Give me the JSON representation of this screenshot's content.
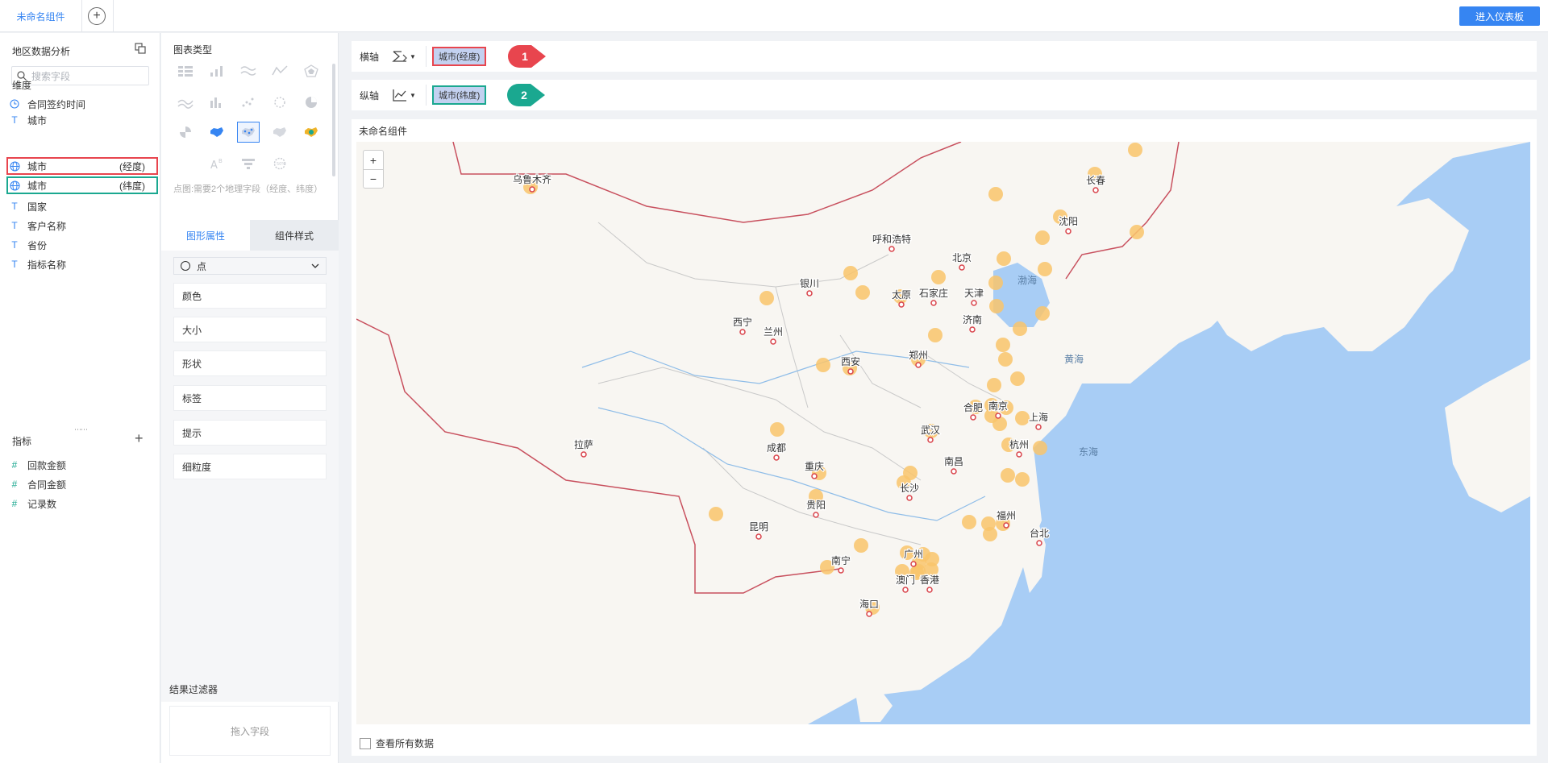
{
  "topbar": {
    "tab_label": "未命名组件",
    "enter_dashboard": "进入仪表板"
  },
  "fields_pane": {
    "dataset_title": "地区数据分析",
    "search_placeholder": "搜索字段",
    "dimensions_title": "维度",
    "dimensions": [
      {
        "icon": "clock-icon",
        "label": "合同签约时间",
        "suffix": ""
      },
      {
        "icon": "text-type-icon",
        "label": "城市",
        "suffix": ""
      },
      {
        "icon": "globe-icon",
        "label": "城市",
        "suffix": "(经度)"
      },
      {
        "icon": "globe-icon",
        "label": "城市",
        "suffix": "(纬度)"
      },
      {
        "icon": "text-type-icon",
        "label": "国家",
        "suffix": ""
      },
      {
        "icon": "text-type-icon",
        "label": "客户名称",
        "suffix": ""
      },
      {
        "icon": "text-type-icon",
        "label": "省份",
        "suffix": ""
      },
      {
        "icon": "text-type-icon",
        "label": "指标名称",
        "suffix": ""
      }
    ],
    "measures_title": "指标",
    "measures": [
      {
        "icon": "hash-icon",
        "label": "回款金额"
      },
      {
        "icon": "hash-icon",
        "label": "合同金额"
      },
      {
        "icon": "hash-icon",
        "label": "记录数"
      }
    ]
  },
  "config_pane": {
    "chart_type_title": "图表类型",
    "chart_type_hint": "点图:需要2个地理字段（经度、纬度）",
    "tabs": [
      "图形属性",
      "组件样式"
    ],
    "shape_select": "点",
    "properties": [
      "颜色",
      "大小",
      "形状",
      "标签",
      "提示",
      "细粒度"
    ],
    "filter_title": "结果过滤器",
    "filter_placeholder": "拖入字段"
  },
  "axes": {
    "x_label": "横轴",
    "x_field": "城市(经度)",
    "y_label": "纵轴",
    "y_field": "城市(纬度)"
  },
  "annotations": {
    "badge_1": "1",
    "badge_2": "2",
    "red": "#e8454e",
    "green": "#1aa890"
  },
  "widget": {
    "title": "未命名组件",
    "show_all": "查看所有数据",
    "zoom_in": "+",
    "zoom_out": "−"
  },
  "map": {
    "cities": [
      "乌鲁木齐",
      "长春",
      "沈阳",
      "呼和浩特",
      "北京",
      "银川",
      "太原",
      "石家庄",
      "天津",
      "西宁",
      "兰州",
      "济南",
      "西安",
      "郑州",
      "拉萨",
      "成都",
      "合肥",
      "南京",
      "上海",
      "武汉",
      "杭州",
      "重庆",
      "南昌",
      "长沙",
      "贵阳",
      "福州",
      "昆明",
      "台北",
      "广州",
      "南宁",
      "澳门",
      "香港",
      "海口"
    ],
    "seas": [
      "渤海",
      "黄海",
      "东海"
    ],
    "accent": "#3685f2",
    "bubble_color": "#f9c46b",
    "water_color": "#a8cdf5",
    "border_color": "#c8505e"
  }
}
